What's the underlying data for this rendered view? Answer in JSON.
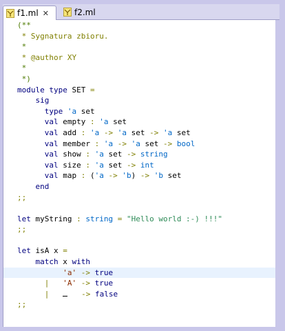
{
  "tabs": [
    {
      "label": "f1.ml",
      "active": true,
      "icon": "ocaml-file-icon"
    },
    {
      "label": "f2.ml",
      "active": false,
      "icon": "ocaml-file-icon"
    }
  ],
  "close_glyph": "✕",
  "code_lines": [
    {
      "t": "(**",
      "cls": "cm"
    },
    {
      "t": " * Sygnatura zbioru.",
      "cls": "doc"
    },
    {
      "t": " *",
      "cls": "cm"
    },
    {
      "t": " * @author XY",
      "cls": "doc"
    },
    {
      "t": " *",
      "cls": "cm"
    },
    {
      "t": " *)",
      "cls": "cm"
    },
    {
      "parts": [
        [
          "kw",
          "module type "
        ],
        [
          "",
          "SET "
        ],
        [
          "op",
          "="
        ]
      ]
    },
    {
      "parts": [
        [
          "kw",
          "    sig"
        ]
      ]
    },
    {
      "parts": [
        [
          "kw",
          "      type "
        ],
        [
          "ty",
          "'a "
        ],
        [
          "",
          "set"
        ]
      ]
    },
    {
      "parts": [
        [
          "kw",
          "      val "
        ],
        [
          "",
          "empty "
        ],
        [
          "op",
          ": "
        ],
        [
          "ty",
          "'a "
        ],
        [
          "",
          "set"
        ]
      ]
    },
    {
      "parts": [
        [
          "kw",
          "      val "
        ],
        [
          "",
          "add "
        ],
        [
          "op",
          ": "
        ],
        [
          "ty",
          "'a "
        ],
        [
          "op",
          "-> "
        ],
        [
          "ty",
          "'a "
        ],
        [
          "",
          "set "
        ],
        [
          "op",
          "-> "
        ],
        [
          "ty",
          "'a "
        ],
        [
          "",
          "set"
        ]
      ]
    },
    {
      "parts": [
        [
          "kw",
          "      val "
        ],
        [
          "",
          "member "
        ],
        [
          "op",
          ": "
        ],
        [
          "ty",
          "'a "
        ],
        [
          "op",
          "-> "
        ],
        [
          "ty",
          "'a "
        ],
        [
          "",
          "set "
        ],
        [
          "op",
          "-> "
        ],
        [
          "ty",
          "bool"
        ]
      ]
    },
    {
      "parts": [
        [
          "kw",
          "      val "
        ],
        [
          "",
          "show "
        ],
        [
          "op",
          ": "
        ],
        [
          "ty",
          "'a "
        ],
        [
          "",
          "set "
        ],
        [
          "op",
          "-> "
        ],
        [
          "ty",
          "string"
        ]
      ]
    },
    {
      "parts": [
        [
          "kw",
          "      val "
        ],
        [
          "",
          "size "
        ],
        [
          "op",
          ": "
        ],
        [
          "ty",
          "'a "
        ],
        [
          "",
          "set "
        ],
        [
          "op",
          "-> "
        ],
        [
          "ty",
          "int"
        ]
      ]
    },
    {
      "parts": [
        [
          "kw",
          "      val "
        ],
        [
          "",
          "map "
        ],
        [
          "op",
          ": "
        ],
        [
          "",
          "("
        ],
        [
          "ty",
          "'a "
        ],
        [
          "op",
          "-> "
        ],
        [
          "ty",
          "'b"
        ],
        [
          "",
          ") "
        ],
        [
          "op",
          "-> "
        ],
        [
          "ty",
          "'b "
        ],
        [
          "",
          "set"
        ]
      ]
    },
    {
      "parts": [
        [
          "kw",
          "    end"
        ]
      ]
    },
    {
      "parts": [
        [
          "op",
          ";;"
        ]
      ]
    },
    {
      "parts": [
        [
          "",
          ""
        ]
      ]
    },
    {
      "parts": [
        [
          "kw",
          "let "
        ],
        [
          "",
          "myString "
        ],
        [
          "op",
          ": "
        ],
        [
          "ty",
          "string "
        ],
        [
          "op",
          "= "
        ],
        [
          "str",
          "\"Hello world :-) !!!\""
        ]
      ]
    },
    {
      "parts": [
        [
          "op",
          ";;"
        ]
      ]
    },
    {
      "parts": [
        [
          "",
          ""
        ]
      ]
    },
    {
      "parts": [
        [
          "kw",
          "let "
        ],
        [
          "",
          "isA x "
        ],
        [
          "op",
          "="
        ]
      ]
    },
    {
      "parts": [
        [
          "kw",
          "    match "
        ],
        [
          "",
          "x "
        ],
        [
          "kw",
          "with"
        ]
      ]
    },
    {
      "parts": [
        [
          "",
          "          "
        ],
        [
          "lit",
          "'a' "
        ],
        [
          "op",
          "-> "
        ],
        [
          "kw",
          "true"
        ]
      ],
      "hl": true
    },
    {
      "parts": [
        [
          "op",
          "      |   "
        ],
        [
          "lit",
          "'A' "
        ],
        [
          "op",
          "-> "
        ],
        [
          "kw",
          "true"
        ]
      ]
    },
    {
      "parts": [
        [
          "op",
          "      |   "
        ],
        [
          "cursor",
          ""
        ],
        [
          "op",
          "   -> "
        ],
        [
          "kw",
          "false"
        ]
      ]
    },
    {
      "parts": [
        [
          "op",
          ";;"
        ]
      ]
    }
  ]
}
